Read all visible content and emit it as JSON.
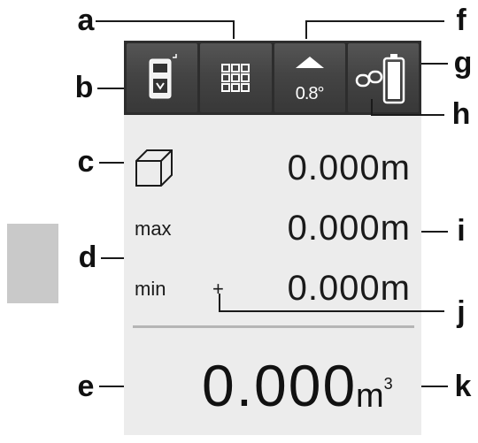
{
  "callouts": {
    "a": "a",
    "b": "b",
    "c": "c",
    "d": "d",
    "e": "e",
    "f": "f",
    "g": "g",
    "h": "h",
    "i": "i",
    "j": "j",
    "k": "k"
  },
  "toolbar": {
    "tilt_value": "0.8°"
  },
  "measurements": {
    "current": {
      "value": "0.000m"
    },
    "max": {
      "label": "max",
      "value": "0.000m"
    },
    "min": {
      "label": "min",
      "value": "0.000m",
      "plus": "+"
    }
  },
  "result": {
    "value": "0.000",
    "unit": "m",
    "unit_exponent": "3"
  },
  "icons": {
    "device": "device-icon",
    "grid": "grid-icon",
    "tilt": "tilt-arrow-icon",
    "bluetooth_link": "link-icon",
    "battery": "battery-icon",
    "cube": "cube-icon"
  },
  "colors": {
    "toolbar": "#2d2d2d",
    "button": "#444444",
    "display": "#ececec",
    "text": "#1a1a1a"
  }
}
